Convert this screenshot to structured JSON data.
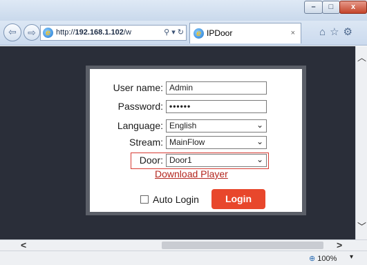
{
  "window": {
    "min_icon": "minimize-icon",
    "max_icon": "maximize-icon",
    "close_glyph": "x"
  },
  "browser": {
    "address": {
      "prefix": "http://",
      "host": "192.168.1.102",
      "suffix": "/w"
    },
    "tab_title": "IPDoor",
    "tab_close": "×",
    "zoom": "100%"
  },
  "login": {
    "username_label": "User name:",
    "username_value": "Admin",
    "password_label": "Password:",
    "password_value": "••••••",
    "language_label": "Language:",
    "language_value": "English",
    "stream_label": "Stream:",
    "stream_value": "MainFlow",
    "door_label": "Door:",
    "door_value": "Door1",
    "download_link": "Download Player",
    "auto_login_label": "Auto Login",
    "login_button": "Login"
  },
  "colors": {
    "accent": "#e8472c",
    "highlight": "#d63a32",
    "page_bg": "#2a2e39"
  }
}
